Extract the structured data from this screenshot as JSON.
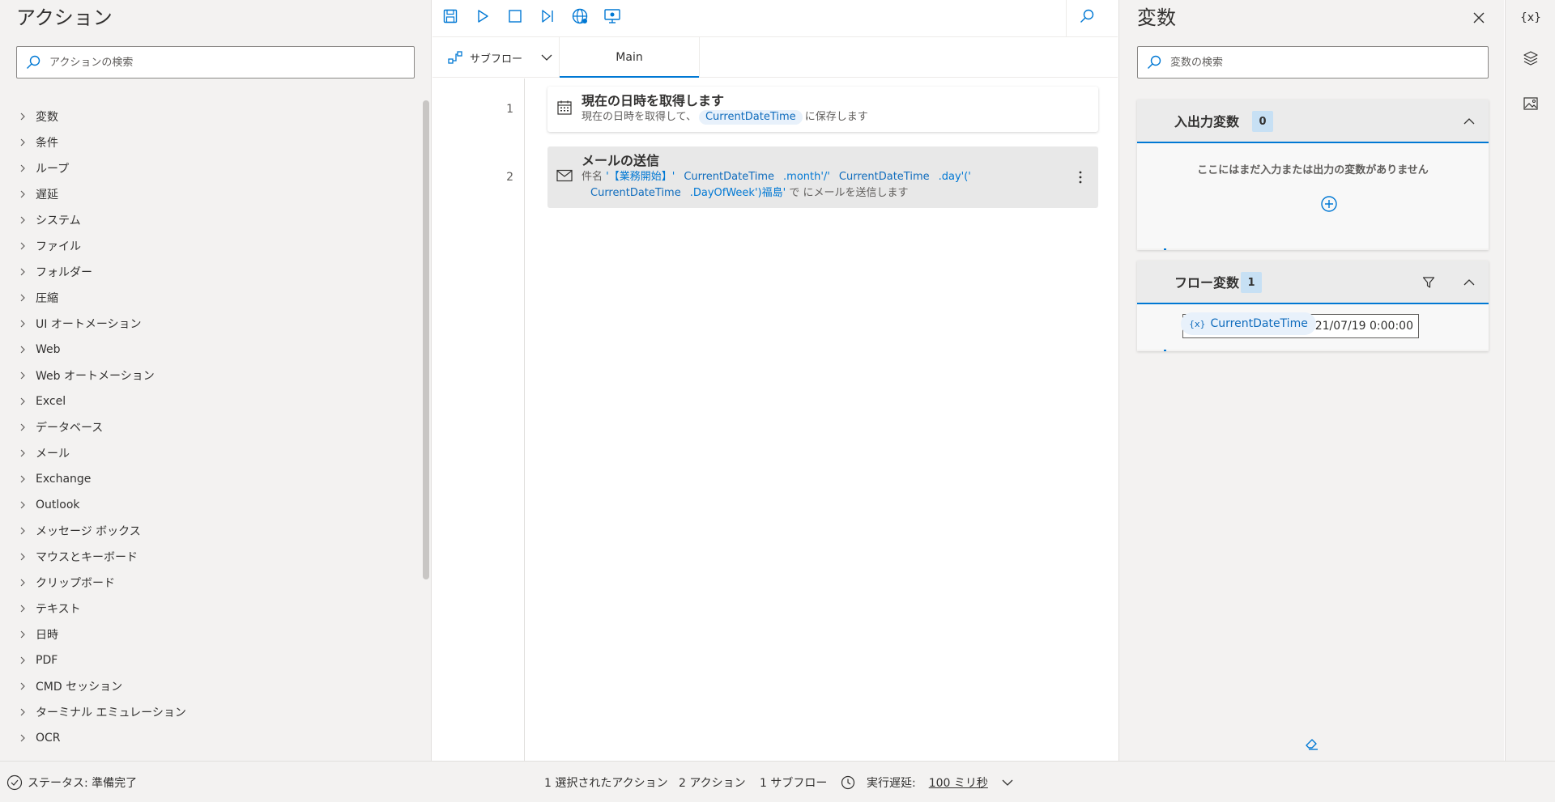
{
  "actions_panel": {
    "title": "アクション",
    "search_placeholder": "アクションの検索",
    "items": [
      "変数",
      "条件",
      "ループ",
      "遅延",
      "システム",
      "ファイル",
      "フォルダー",
      "圧縮",
      "UI オートメーション",
      "Web",
      "Web オートメーション",
      "Excel",
      "データベース",
      "メール",
      "Exchange",
      "Outlook",
      "メッセージ ボックス",
      "マウスとキーボード",
      "クリップボード",
      "テキスト",
      "日時",
      "PDF",
      "CMD セッション",
      "ターミナル エミュレーション",
      "OCR"
    ]
  },
  "toolbar": {
    "icons": [
      "save-icon",
      "run-icon",
      "stop-icon",
      "step-icon",
      "web-recorder-icon",
      "desktop-recorder-icon",
      "search-icon"
    ]
  },
  "tabs": {
    "subflow_label": "サブフロー",
    "main_tab": "Main"
  },
  "steps": [
    {
      "number": "1",
      "title": "現在の日時を取得します",
      "desc_prefix": "現在の日時を取得して、",
      "var": "CurrentDateTime",
      "desc_suffix": "に保存します"
    },
    {
      "number": "2",
      "title": "メールの送信",
      "subject_label": "件名",
      "part1": "'【業務開始】'",
      "var1": "CurrentDateTime",
      "part2": ".month'/'",
      "var2": "CurrentDateTime",
      "part3": ".day'('",
      "var3": "CurrentDateTime",
      "part4": ".DayOfWeek')福島'",
      "de": "で",
      "suffix": "にメールを送信します"
    }
  ],
  "variables_panel": {
    "title": "変数",
    "search_placeholder": "変数の検索",
    "io_section": {
      "title": "入出力変数",
      "count": "0",
      "empty_message": "ここにはまだ入力または出力の変数がありません"
    },
    "flow_section": {
      "title": "フロー変数",
      "count": "1",
      "var_badge": "{x}",
      "var_name": "CurrentDateTime",
      "var_value": "2021/07/19 0:00:00"
    }
  },
  "rail": {
    "variables_label": "{x}"
  },
  "status_bar": {
    "status": "ステータス: 準備完了",
    "selected": "1 選択されたアクション",
    "actions": "2 アクション",
    "subflows": "1 サブフロー",
    "delay_label": "実行遅延:",
    "delay_value": "100 ミリ秒"
  },
  "colors": {
    "accent": "#0078d4",
    "panel_bg": "#f3f2f1",
    "variable_token": "#0f6cbd"
  }
}
